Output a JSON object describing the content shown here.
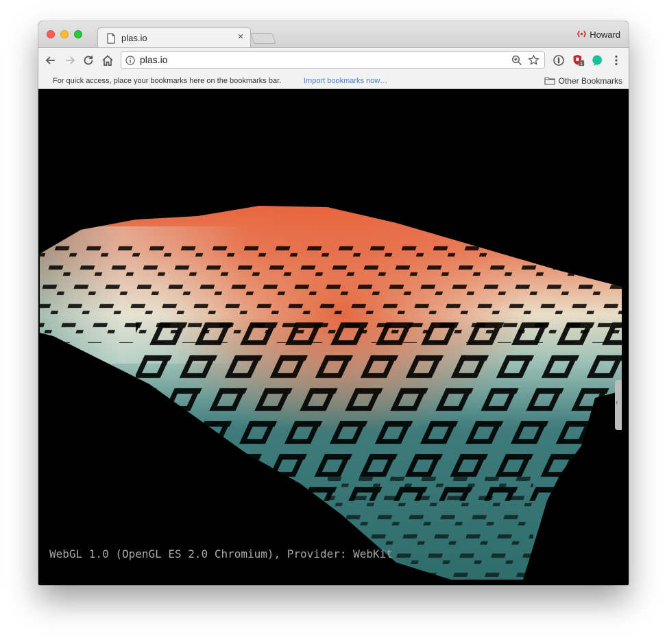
{
  "browser": {
    "tab": {
      "title": "plas.io",
      "close_glyph": "×"
    },
    "profile_name": "Howard",
    "address": {
      "url": "plas.io"
    },
    "bookmarks_bar": {
      "prompt": "For quick access, place your bookmarks here on the bookmarks bar.",
      "import_link": "Import bookmarks now…",
      "other_bookmarks": "Other Bookmarks"
    },
    "extension_badge": "1"
  },
  "viewer": {
    "renderer_info": "WebGL 1.0 (OpenGL ES 2.0 Chromium), Provider: WebKit",
    "colors": {
      "high": "#e8613a",
      "mid": "#e9ddc6",
      "low": "#2f6c6c",
      "background": "#000000"
    },
    "side_panel_toggle_glyph": "‹"
  },
  "icons": [
    "page-icon",
    "back-icon",
    "forward-icon",
    "reload-icon",
    "home-icon",
    "info-icon",
    "zoom-icon",
    "star-icon",
    "password-icon",
    "shield-extension-icon",
    "grammarly-icon",
    "menu-icon",
    "folder-icon"
  ]
}
